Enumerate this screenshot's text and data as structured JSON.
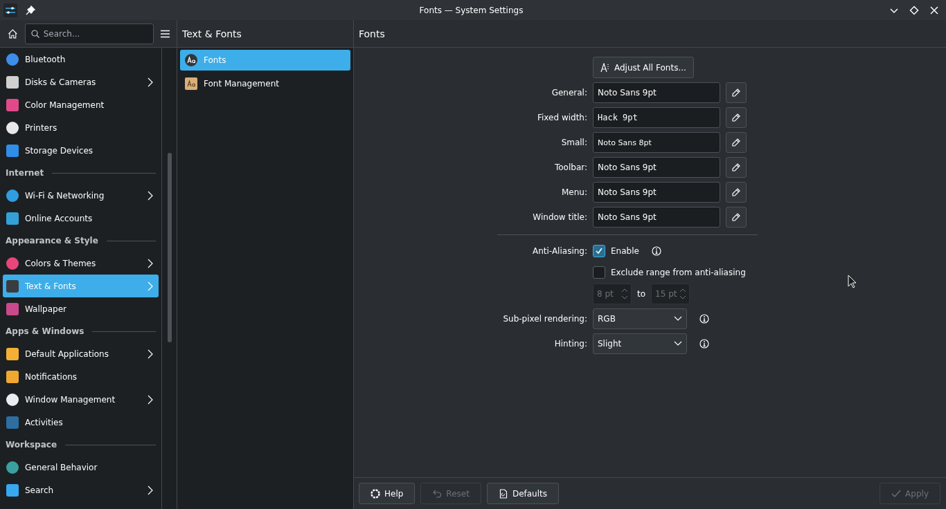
{
  "window": {
    "title": "Fonts — System Settings"
  },
  "sidebar": {
    "search": {
      "placeholder": "Search..."
    },
    "items": [
      {
        "kind": "item",
        "label": "Bluetooth",
        "selected": false,
        "has_arrow": false
      },
      {
        "kind": "item",
        "label": "Disks & Cameras",
        "selected": false,
        "has_arrow": true
      },
      {
        "kind": "item",
        "label": "Color Management",
        "selected": false,
        "has_arrow": false
      },
      {
        "kind": "item",
        "label": "Printers",
        "selected": false,
        "has_arrow": false
      },
      {
        "kind": "item",
        "label": "Storage Devices",
        "selected": false,
        "has_arrow": false
      },
      {
        "kind": "section",
        "label": "Internet"
      },
      {
        "kind": "item",
        "label": "Wi-Fi & Networking",
        "selected": false,
        "has_arrow": true
      },
      {
        "kind": "item",
        "label": "Online Accounts",
        "selected": false,
        "has_arrow": false
      },
      {
        "kind": "section",
        "label": "Appearance & Style"
      },
      {
        "kind": "item",
        "label": "Colors & Themes",
        "selected": false,
        "has_arrow": true
      },
      {
        "kind": "item",
        "label": "Text & Fonts",
        "selected": true,
        "has_arrow": true
      },
      {
        "kind": "item",
        "label": "Wallpaper",
        "selected": false,
        "has_arrow": false
      },
      {
        "kind": "section",
        "label": "Apps & Windows"
      },
      {
        "kind": "item",
        "label": "Default Applications",
        "selected": false,
        "has_arrow": true
      },
      {
        "kind": "item",
        "label": "Notifications",
        "selected": false,
        "has_arrow": false
      },
      {
        "kind": "item",
        "label": "Window Management",
        "selected": false,
        "has_arrow": true
      },
      {
        "kind": "item",
        "label": "Activities",
        "selected": false,
        "has_arrow": false
      },
      {
        "kind": "section",
        "label": "Workspace"
      },
      {
        "kind": "item",
        "label": "General Behavior",
        "selected": false,
        "has_arrow": false
      },
      {
        "kind": "item",
        "label": "Search",
        "selected": false,
        "has_arrow": true
      }
    ]
  },
  "subpanel": {
    "title": "Text & Fonts",
    "items": [
      {
        "label": "Fonts",
        "selected": true
      },
      {
        "label": "Font Management",
        "selected": false
      }
    ]
  },
  "page": {
    "title": "Fonts",
    "adjust_button": "Adjust All Fonts...",
    "font_rows": [
      {
        "label": "General:",
        "value": "Noto Sans 9pt",
        "kind": "sans"
      },
      {
        "label": "Fixed width:",
        "value": "Hack 9pt",
        "kind": "mono"
      },
      {
        "label": "Small:",
        "value": "Noto Sans 8pt",
        "kind": "small"
      },
      {
        "label": "Toolbar:",
        "value": "Noto Sans 9pt",
        "kind": "sans"
      },
      {
        "label": "Menu:",
        "value": "Noto Sans 9pt",
        "kind": "sans"
      },
      {
        "label": "Window title:",
        "value": "Noto Sans 9pt",
        "kind": "sans"
      }
    ],
    "anti_aliasing": {
      "label": "Anti-Aliasing:",
      "enable": {
        "label": "Enable",
        "checked": true
      },
      "exclude": {
        "label": "Exclude range from anti-aliasing",
        "checked": false
      },
      "range_from": {
        "value": "8 pt",
        "disabled": true
      },
      "range_to_label": "to",
      "range_to": {
        "value": "15 pt",
        "disabled": true
      }
    },
    "dropdowns": [
      {
        "label": "Sub-pixel rendering:",
        "value": "RGB"
      },
      {
        "label": "Hinting:",
        "value": "Slight"
      }
    ]
  },
  "footer": {
    "buttons": [
      {
        "label": "Help",
        "kind": "help",
        "disabled": false
      },
      {
        "label": "Reset",
        "kind": "reset",
        "disabled": true
      },
      {
        "label": "Defaults",
        "kind": "defaults",
        "disabled": false
      },
      {
        "label": "Apply",
        "kind": "apply",
        "disabled": true
      }
    ]
  }
}
